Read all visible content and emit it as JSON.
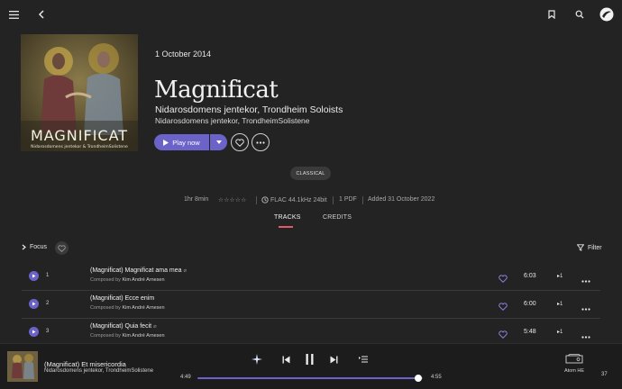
{
  "topbar": {
    "menu_icon": "hamburger-icon",
    "back_icon": "chevron-left-icon",
    "bookmark_icon": "bookmark-icon",
    "search_icon": "search-icon",
    "logo_icon": "app-logo-icon"
  },
  "album": {
    "cover_text": "MAGNIFICAT",
    "cover_subtext": "Nidarosdomens jentekor & TrondheimSolistene",
    "release_date": "1 October 2014",
    "title": "Magnificat",
    "artist_primary": "Nidarosdomens jentekor, Trondheim Soloists",
    "artist_secondary": "Nidarosdomens jentekor, TrondheimSolistene",
    "play_label": "Play now",
    "genre": "CLASSICAL",
    "duration": "1hr 8min",
    "rating_stars": "☆☆☆☆☆",
    "format": "FLAC 44.1kHz 24bit",
    "pdf": "1 PDF",
    "added": "Added 31 October 2022"
  },
  "tabs": [
    {
      "label": "TRACKS",
      "active": true
    },
    {
      "label": "CREDITS",
      "active": false
    }
  ],
  "toolbar": {
    "focus_label": "Focus",
    "filter_label": "Filter"
  },
  "tracks": [
    {
      "num": "1",
      "title": "(Magnificat) Magnificat ama mea",
      "composed_prefix": "Composed by",
      "composer": "Kim André Arnesen",
      "duration": "6:03",
      "plays": "1"
    },
    {
      "num": "2",
      "title": "(Magnificat) Ecce enim",
      "composed_prefix": "Composed by",
      "composer": "Kim André Arnesen",
      "duration": "6:00",
      "plays": "1"
    },
    {
      "num": "3",
      "title": "(Magnificat) Quia fecit",
      "composed_prefix": "Composed by",
      "composer": "Kim André Arnesen",
      "duration": "5:48",
      "plays": "1"
    }
  ],
  "player": {
    "title": "(Magnificat) Et misericordia",
    "artist": "Nidarosdomens jentekor, TrondheimSolistene",
    "elapsed": "4:49",
    "total": "4:55",
    "progress": 0.98,
    "device": "Atom HE",
    "volume": "37"
  },
  "colors": {
    "accent": "#6c63c9",
    "background": "#232323",
    "tab_underline": "#e05a6a"
  }
}
